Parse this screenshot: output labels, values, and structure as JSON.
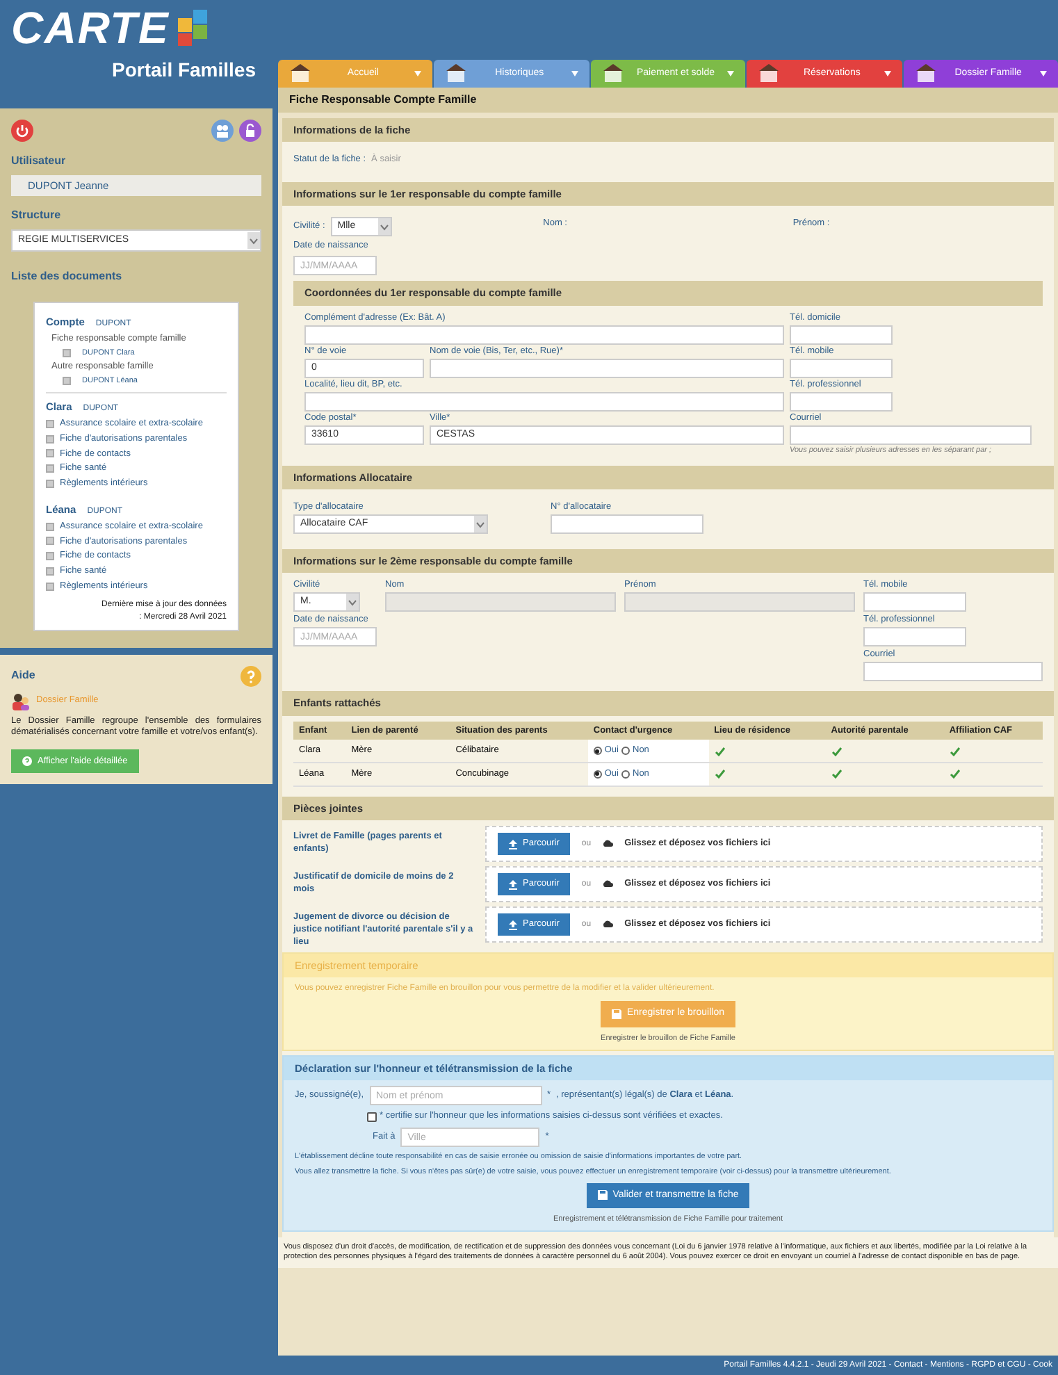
{
  "sidebar": {
    "logo": "CARTE",
    "subtitle": "Portail Familles",
    "user_label": "Utilisateur",
    "user": "DUPONT Jeanne",
    "structure_label": "Structure",
    "structure": "REGIE MULTISERVICES",
    "docs_label": "Liste des documents",
    "groups": [
      {
        "title": "Compte",
        "name": "DUPONT",
        "items": [
          {
            "kind": "heading",
            "label": "Fiche responsable compte famille"
          },
          {
            "kind": "sub",
            "label": "DUPONT Clara",
            "checked": false
          },
          {
            "kind": "heading",
            "label": "Autre responsable famille"
          },
          {
            "kind": "sub",
            "label": "DUPONT Léana",
            "checked": false
          }
        ]
      },
      {
        "title": "Clara",
        "name": "DUPONT",
        "items": [
          {
            "kind": "doc",
            "label": "Assurance scolaire et extra-scolaire",
            "checked": false
          },
          {
            "kind": "doc",
            "label": "Fiche d'autorisations parentales",
            "checked": false
          },
          {
            "kind": "doc",
            "label": "Fiche de contacts",
            "checked": false
          },
          {
            "kind": "doc",
            "label": "Fiche santé",
            "checked": false
          },
          {
            "kind": "doc",
            "label": "Règlements intérieurs",
            "checked": false
          }
        ]
      },
      {
        "title": "Léana",
        "name": "DUPONT",
        "items": [
          {
            "kind": "doc",
            "label": "Assurance scolaire et extra-scolaire",
            "checked": false
          },
          {
            "kind": "doc",
            "label": "Fiche d'autorisations parentales",
            "checked": false
          },
          {
            "kind": "doc",
            "label": "Fiche de contacts",
            "checked": false
          },
          {
            "kind": "doc",
            "label": "Fiche santé",
            "checked": false
          },
          {
            "kind": "doc",
            "label": "Règlements intérieurs",
            "checked": false
          }
        ]
      }
    ],
    "update_note": "Dernière mise à jour des données",
    "update_date": ": Mercredi 28 Avril 2021"
  },
  "help": {
    "title": "Aide",
    "topic": "Dossier Famille",
    "text": "Le Dossier Famille regroupe l'ensemble des formulaires dématérialisés concernant votre famille et votre/vos enfant(s).",
    "button": "Afficher l'aide détaillée"
  },
  "tabs": [
    {
      "label": "Accueil",
      "color": "#e9a83b"
    },
    {
      "label": "Historiques",
      "color": "#6f9fd6"
    },
    {
      "label": "Paiement et solde",
      "color": "#7dbb48"
    },
    {
      "label": "Réservations",
      "color": "#e2413f"
    },
    {
      "label": "Dossier Famille",
      "color": "#8f3fd8"
    }
  ],
  "page_title": "Fiche Responsable Compte Famille",
  "fiche": {
    "title": "Informations de la fiche",
    "status_label": "Statut de la fiche :",
    "status": "À saisir"
  },
  "resp1": {
    "title": "Informations sur le 1er responsable du compte famille",
    "civilite_label": "Civilité :",
    "civilite": "Mlle",
    "nom_label": "Nom :",
    "prenom_label": "Prénom :",
    "naissance_label": "Date de naissance",
    "naissance_placeholder": "JJ/MM/AAAA",
    "coord_title": "Coordonnées du 1er responsable du compte famille",
    "complement": "Complément d'adresse (Ex: Bât. A)",
    "numero_label": "N° de voie",
    "numero": "0",
    "voie": "Nom de voie (Bis, Ter, etc., Rue)*",
    "localite": "Localité, lieu dit, BP, etc.",
    "cp_label": "Code postal*",
    "cp": "33610",
    "ville_label": "Ville*",
    "ville": "CESTAS",
    "tel_domicile": "Tél. domicile",
    "tel_mobile": "Tél. mobile",
    "tel_pro": "Tél. professionnel",
    "courriel": "Courriel",
    "courriel_hint": "Vous pouvez saisir plusieurs adresses en les séparant par ;"
  },
  "allocataire": {
    "title": "Informations Allocataire",
    "type_label": "Type d'allocataire",
    "type": "Allocataire CAF",
    "numero_label": "N° d'allocataire"
  },
  "resp2": {
    "title": "Informations sur le 2ème responsable du compte famille",
    "civilite_label": "Civilité",
    "civilite": "M.",
    "nom_label": "Nom",
    "prenom_label": "Prénom",
    "mobile_label": "Tél. mobile",
    "naissance_label": "Date de naissance",
    "naissance_placeholder": "JJ/MM/AAAA",
    "pro_label": "Tél. professionnel",
    "courriel_label": "Courriel"
  },
  "enfants": {
    "title": "Enfants rattachés",
    "columns": [
      "Enfant",
      "Lien de parenté",
      "Situation des parents",
      "Contact d'urgence",
      "Lieu de résidence",
      "Autorité parentale",
      "Affiliation CAF"
    ],
    "rows": [
      {
        "enfant": "Clara",
        "lien": "Mère",
        "situation": "Célibataire",
        "contact": [
          {
            "label": "Oui",
            "selected": true
          },
          {
            "label": "Non",
            "selected": false
          }
        ],
        "residence": true,
        "autorite": true,
        "caf": true
      },
      {
        "enfant": "Léana",
        "lien": "Mère",
        "situation": "Concubinage",
        "contact": [
          {
            "label": "Oui",
            "selected": true
          },
          {
            "label": "Non",
            "selected": false
          }
        ],
        "residence": true,
        "autorite": true,
        "caf": true
      }
    ]
  },
  "pieces": {
    "title": "Pièces jointes",
    "items": [
      {
        "label": "Livret de Famille (pages parents et enfants)",
        "button": "Parcourir",
        "or": "ou",
        "drop": "Glissez et déposez vos fichiers ici"
      },
      {
        "label": "Justificatif de domicile de moins de 2 mois",
        "button": "Parcourir",
        "or": "ou",
        "drop": "Glissez et déposez vos fichiers ici"
      },
      {
        "label": "Jugement de divorce ou décision de justice notifiant l'autorité parentale s'il y a lieu",
        "button": "Parcourir",
        "or": "ou",
        "drop": "Glissez et déposez vos fichiers ici"
      }
    ]
  },
  "brouillon": {
    "title": "Enregistrement temporaire",
    "text": "Vous pouvez enregistrer Fiche Famille en brouillon pour vous permettre de la modifier et la valider ultérieurement.",
    "button": "Enregistrer le brouillon",
    "caption": "Enregistrer le brouillon de Fiche Famille"
  },
  "declaration": {
    "title": "Déclaration sur l'honneur et télétransmission de la fiche",
    "je": "Je, soussigné(e),",
    "nom_placeholder": "Nom et prénom",
    "star": "*",
    "representant": ", représentant(s) légal(s) de **Clara** et **Léana**.",
    "certify_checked": false,
    "certify": "* certifie sur l'honneur que les informations saisies ci-dessus sont vérifiées et exactes.",
    "fait_label": "Fait à",
    "fait_placeholder": "Ville",
    "fait_star": "*",
    "note1": "L'établissement décline toute responsabilité en cas de saisie erronée ou omission de saisie d'informations importantes de votre part.",
    "note2": "Vous allez transmettre la fiche. Si vous n'êtes pas sûr(e) de votre saisie, vous pouvez effectuer un enregistrement temporaire (voir ci-dessus) pour la transmettre ultérieurement.",
    "button": "Valider et transmettre la fiche",
    "caption": "Enregistrement et télétransmission de Fiche Famille pour traitement"
  },
  "legal": "Vous disposez d'un droit d'accès, de modification, de rectification et de suppression des données vous concernant (Loi du 6 janvier 1978 relative à l'informatique, aux fichiers et aux libertés, modifiée par la Loi relative à la protection des personnes physiques à l'égard des traitements de données à caractère personnel du 6 août 2004). Vous pouvez exercer ce droit en envoyant un courriel à l'adresse de contact disponible en bas de page.",
  "footer": "Portail Familles 4.4.2.1 - Jeudi 29 Avril 2021 - Contact - Mentions - RGPD et CGU - Cook"
}
